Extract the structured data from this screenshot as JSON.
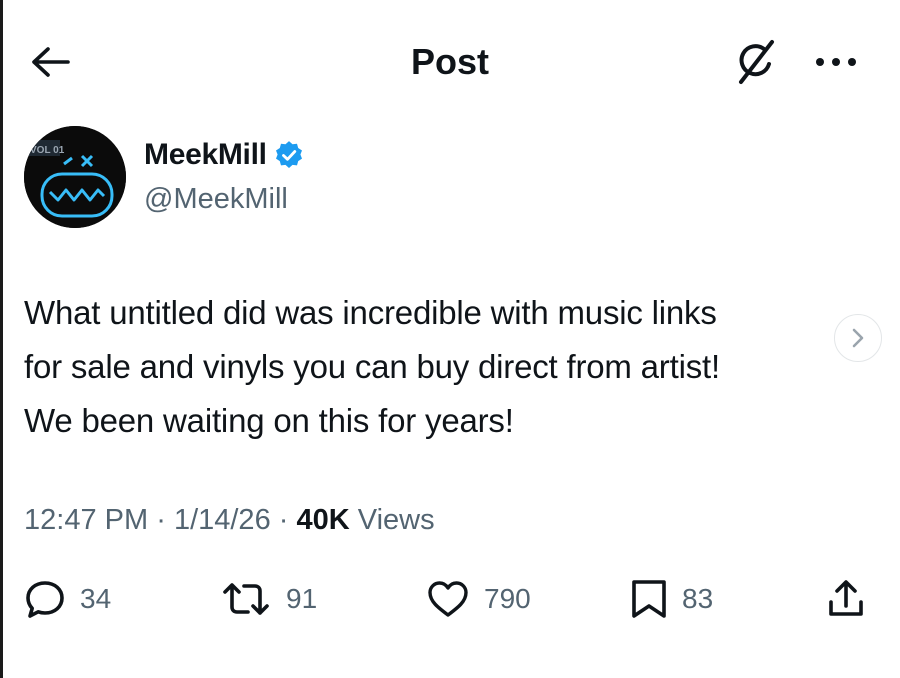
{
  "header": {
    "title": "Post",
    "back_icon": "arrow-left-icon",
    "grok_icon": "grok-icon",
    "more_icon": "more-horizontal-icon"
  },
  "author": {
    "name": "MeekMill",
    "handle": "@MeekMill",
    "verified": true,
    "verified_color": "#1d9bf0",
    "avatar_label": "VOL 01"
  },
  "post": {
    "text": "What untitled did was incredible with music links\nfor sale and vinyls you can buy direct from artist!\nWe been waiting on this for years!"
  },
  "meta": {
    "time": "12:47 PM",
    "separator": "·",
    "date": "1/14/26",
    "views_count": "40K",
    "views_label": "Views"
  },
  "actions": {
    "replies": "34",
    "reposts": "91",
    "likes": "790",
    "bookmarks": "83"
  },
  "colors": {
    "text_primary": "#0f1419",
    "text_secondary": "#536471",
    "accent": "#1d9bf0",
    "avatar_glow": "#38bdf8"
  }
}
